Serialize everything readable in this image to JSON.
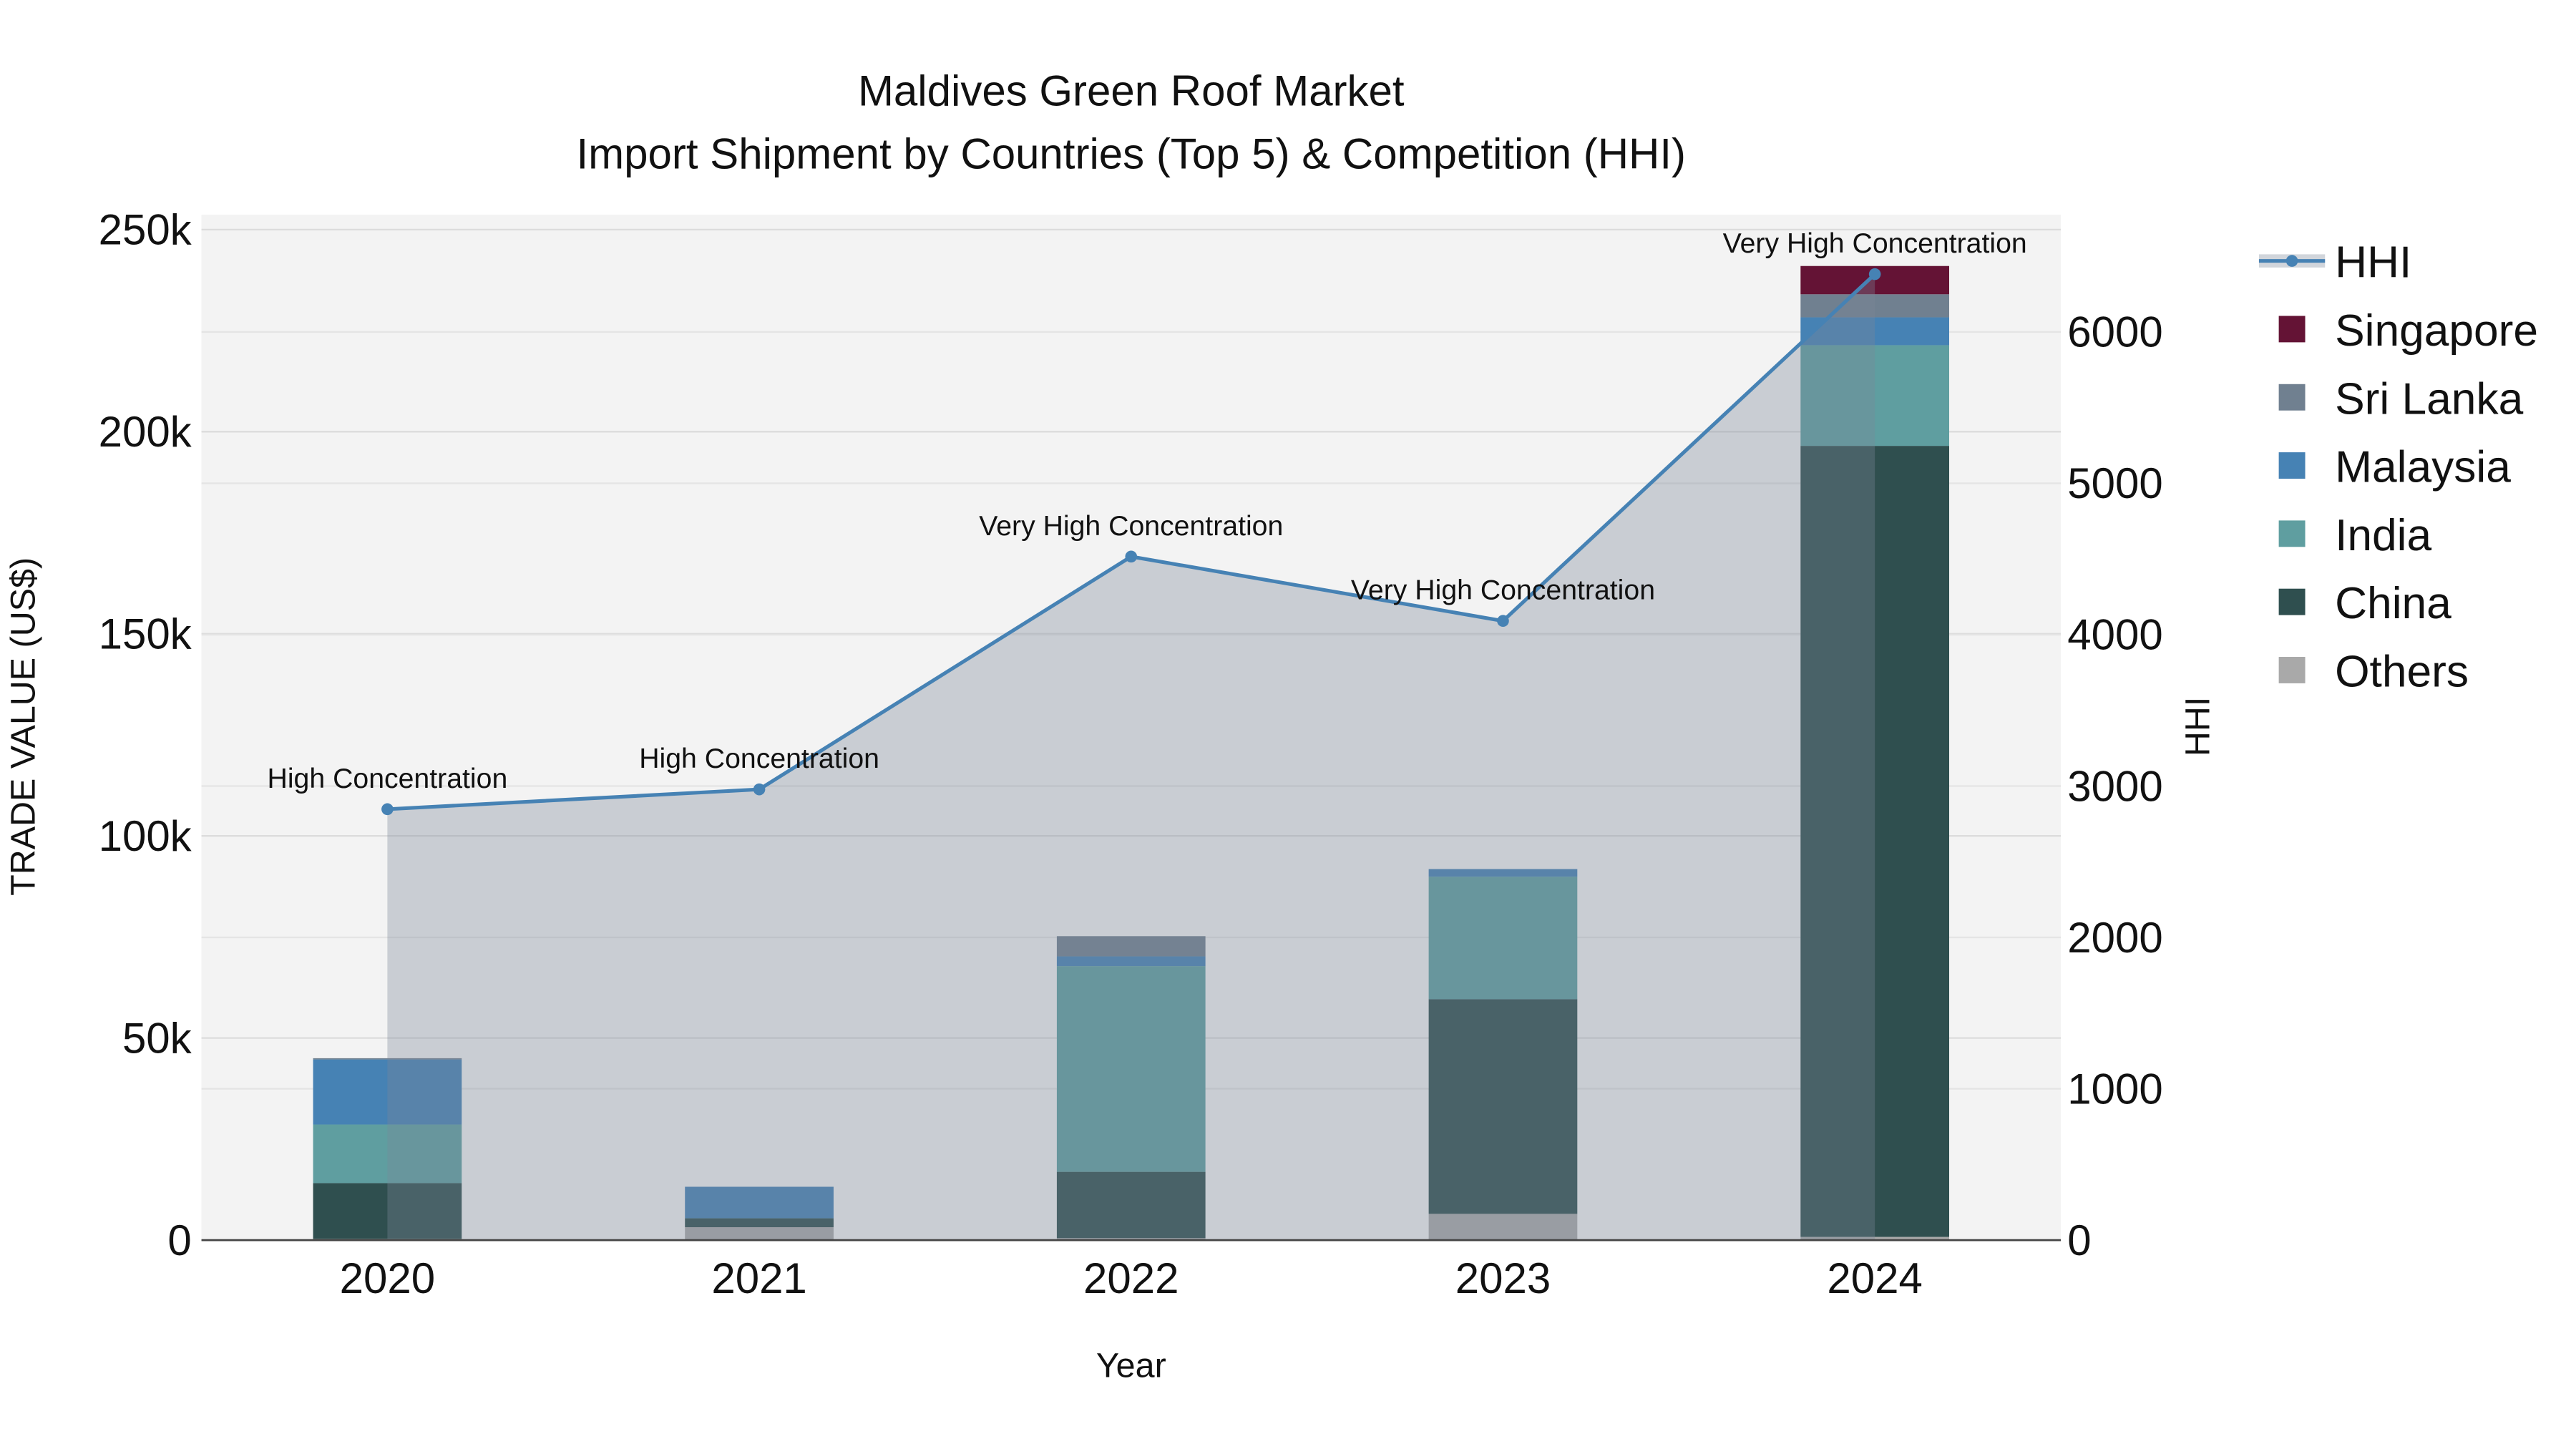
{
  "chart_data": {
    "type": "bar",
    "title_line1": "Maldives Green Roof Market",
    "title_line2": "Import Shipment by Countries (Top 5) & Competition (HHI)",
    "xlabel": "Year",
    "ylabel": "TRADE VALUE (US$)",
    "y2label": "HHI",
    "categories": [
      "2020",
      "2021",
      "2022",
      "2023",
      "2024"
    ],
    "ylim": [
      0,
      253700
    ],
    "y2lim": [
      0,
      6775
    ],
    "yticks": [
      0,
      50000,
      100000,
      150000,
      200000,
      250000
    ],
    "ytick_labels": [
      "0",
      "50k",
      "100k",
      "150k",
      "200k",
      "250k"
    ],
    "y2ticks": [
      0,
      1000,
      2000,
      3000,
      4000,
      5000,
      6000
    ],
    "y2tick_labels": [
      "0",
      "1000",
      "2000",
      "3000",
      "4000",
      "5000",
      "6000"
    ],
    "stacked": true,
    "series": [
      {
        "name": "Others",
        "color": "#a9a9a9",
        "values": [
          300,
          3200,
          500,
          6500,
          800
        ]
      },
      {
        "name": "China",
        "color": "#2f4f4f",
        "values": [
          13800,
          2200,
          16400,
          53100,
          195700
        ]
      },
      {
        "name": "India",
        "color": "#5f9ea0",
        "values": [
          14500,
          0,
          50900,
          30300,
          24900
        ]
      },
      {
        "name": "Malaysia",
        "color": "#4682b4",
        "values": [
          16100,
          7800,
          2400,
          1900,
          6900
        ]
      },
      {
        "name": "Sri Lanka",
        "color": "#708090",
        "values": [
          300,
          0,
          5000,
          0,
          5700
        ]
      },
      {
        "name": "Singapore",
        "color": "#641335",
        "values": [
          0,
          0,
          0,
          0,
          7000
        ]
      }
    ],
    "line_series": {
      "name": "HHI",
      "axis": "right",
      "color": "#4682b4",
      "values": [
        2847,
        2978,
        4516,
        4091,
        6382
      ],
      "annotations": [
        "High Concentration",
        "High Concentration",
        "Very High Concentration",
        "Very High Concentration",
        "Very High Concentration"
      ]
    },
    "legend_order": [
      "HHI",
      "Singapore",
      "Sri Lanka",
      "Malaysia",
      "India",
      "China",
      "Others"
    ],
    "legend_position": "right",
    "grid": true
  }
}
